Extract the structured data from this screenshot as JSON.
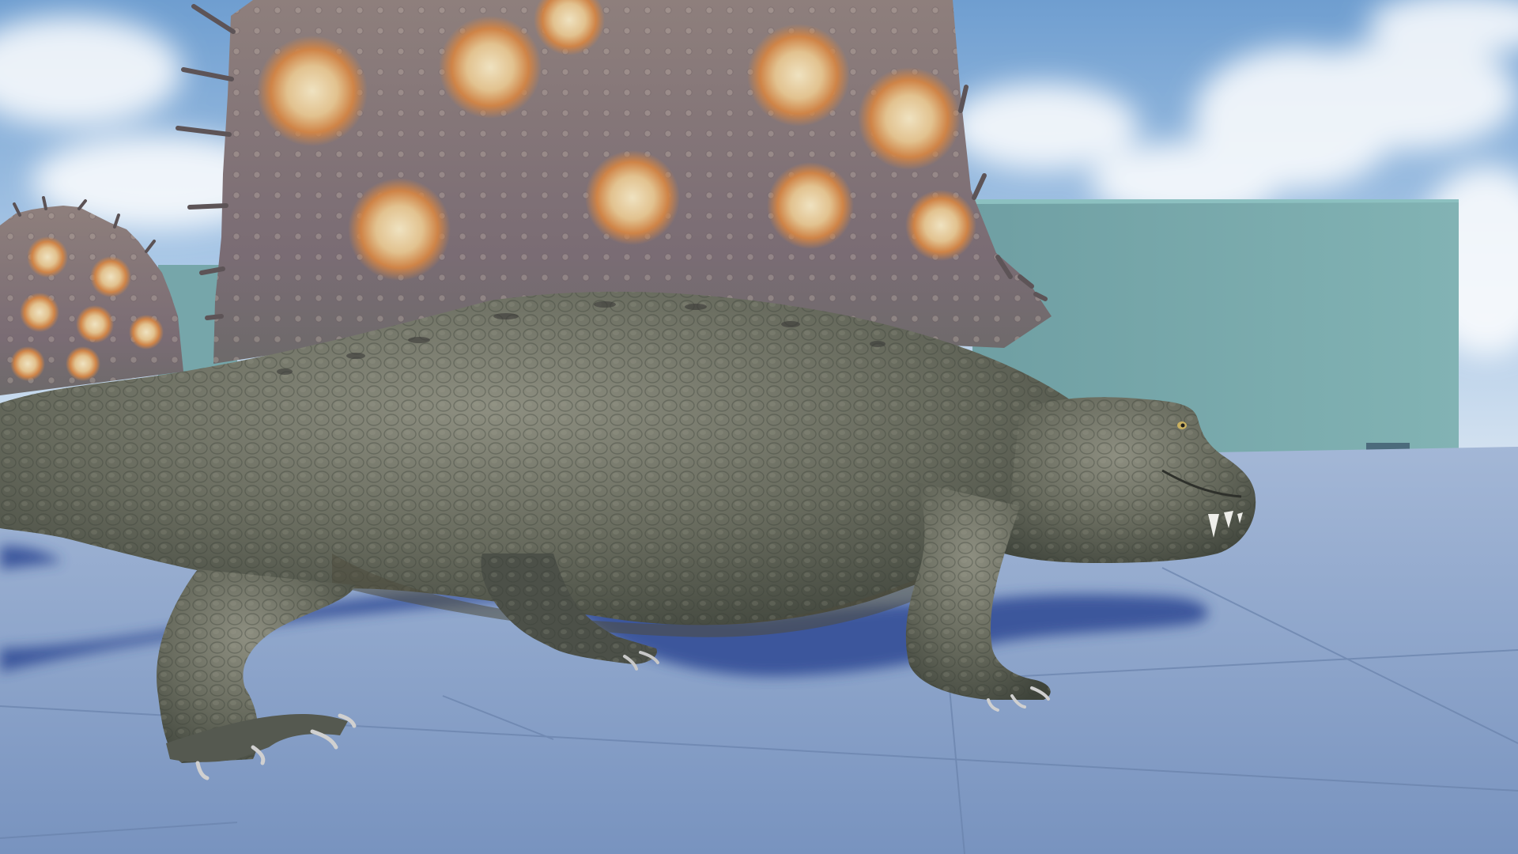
{
  "scene": {
    "colors": {
      "sky_top": "#6f9ed0",
      "sky_mid": "#a9c7e6",
      "sky_bottom": "#d7e4f1",
      "cloud": "#ffffff",
      "wall": "#7aaeb0",
      "wall_shadow": "#6a9b9f",
      "floor_near": "#7e99c3",
      "floor_far": "#9db2d2",
      "floor_grid": "#6b84ad",
      "shadow": "#2d4894",
      "skin_dark": "#4a4f45",
      "skin_mid": "#6f7266",
      "skin_light": "#8b8c7e",
      "sail_base": "#7a6a70",
      "sail_spot": "#d38a4a",
      "sail_spot_center": "#e8d6b0",
      "claw": "#cfcfcf"
    },
    "icons": [
      "dimetrodon-model",
      "cloud-shape",
      "sail-spine"
    ]
  }
}
